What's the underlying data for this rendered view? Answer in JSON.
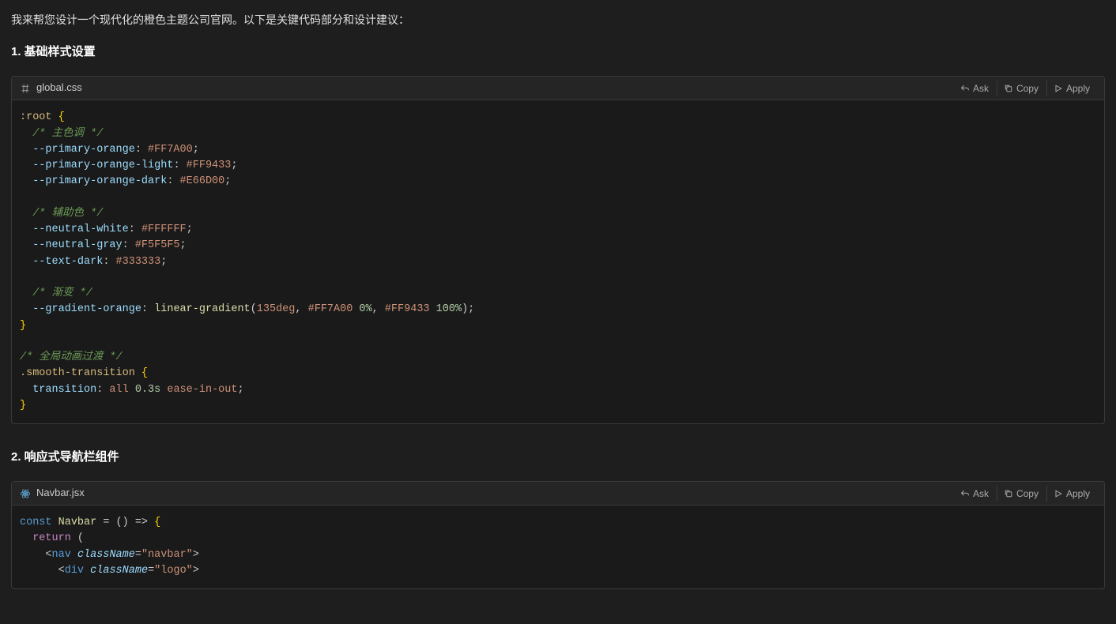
{
  "intro": "我来帮您设计一个现代化的橙色主题公司官网。以下是关键代码部分和设计建议：",
  "section1_heading": "1. 基础样式设置",
  "section2_heading": "2. 响应式导航栏组件",
  "codeblock1": {
    "filename": "global.css",
    "icon": "hash-icon",
    "actions": {
      "ask": "Ask",
      "copy": "Copy",
      "apply": "Apply"
    },
    "tokens": {
      "sel_root": ":root",
      "brace_open": " {",
      "brace_close": "}",
      "c_primary": "/* 主色调 */",
      "p_po": "  --primary-orange",
      "v_po": "#FF7A00",
      "p_pol": "  --primary-orange-light",
      "v_pol": "#FF9433",
      "p_pod": "  --primary-orange-dark",
      "v_pod": "#E66D00",
      "c_aux": "/* 辅助色 */",
      "p_nw": "  --neutral-white",
      "v_nw": "#FFFFFF",
      "p_ng": "  --neutral-gray",
      "v_ng": "#F5F5F5",
      "p_td": "  --text-dark",
      "v_td": "#333333",
      "c_grad": "/* 渐变 */",
      "p_go": "  --gradient-orange",
      "fn_lg": "linear-gradient",
      "lg_arg1": "135deg",
      "lg_arg2a": "#FF7A00",
      "lg_arg2b": "0%",
      "lg_arg3a": "#FF9433",
      "lg_arg3b": "100%",
      "c_global": "/* 全局动画过渡 */",
      "sel_smooth": ".smooth-transition",
      "p_trans": "  transition",
      "v_trans_all": "all",
      "v_trans_dur": "0.3s",
      "v_trans_ease": "ease-in-out",
      "colon": ": ",
      "semi": ";",
      "comma": ", ",
      "paren_open": "(",
      "paren_close": ")"
    }
  },
  "codeblock2": {
    "filename": "Navbar.jsx",
    "icon": "react-icon",
    "actions": {
      "ask": "Ask",
      "copy": "Copy",
      "apply": "Apply"
    },
    "tokens": {
      "kw_const": "const",
      "name_navbar": " Navbar ",
      "eq": "= ",
      "arrow": "() => ",
      "brace_open": "{",
      "brace_close": "}",
      "kw_return": "  return",
      "paren_open": " (",
      "lt": "<",
      "gt": ">",
      "tag_nav": "nav",
      "tag_div": "div",
      "attr_classname": "className",
      "eq2": "=",
      "val_navbar": "\"navbar\"",
      "val_logo": "\"logo\""
    }
  }
}
